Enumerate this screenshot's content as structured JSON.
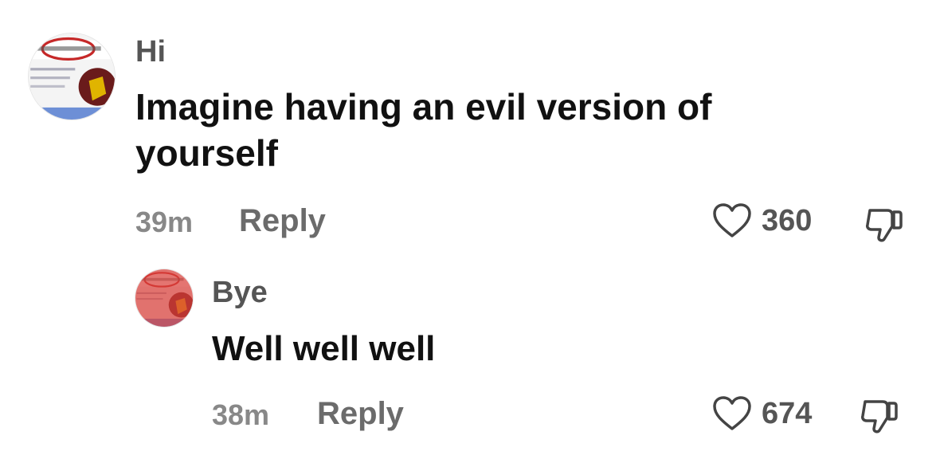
{
  "comments": [
    {
      "username": "Hi",
      "text": "Imagine having an evil version of yourself",
      "time": "39m",
      "reply_label": "Reply",
      "likes": "360",
      "avatar_icon": "meme-collage-avatar"
    },
    {
      "username": "Bye",
      "text": "Well well well",
      "time": "38m",
      "reply_label": "Reply",
      "likes": "674",
      "avatar_icon": "meme-collage-avatar-red-tint"
    }
  ],
  "colors": {
    "background": "#ffffff",
    "text": "#111111",
    "username": "#555555",
    "meta": "#888888",
    "icon": "#444444",
    "avatar_red_tint": "#d9403a"
  }
}
